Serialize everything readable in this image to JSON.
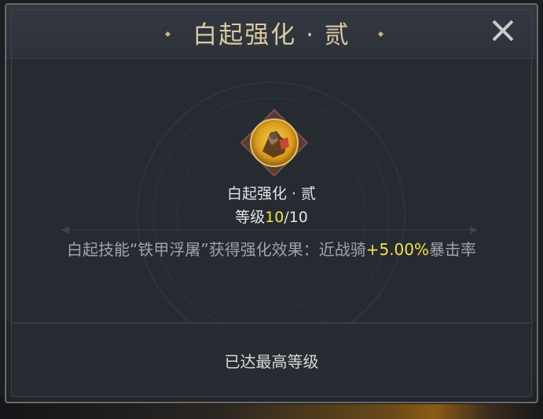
{
  "dialog": {
    "title": "白起强化 · 贰",
    "close_icon": "close-x-icon"
  },
  "skill": {
    "icon": "warrior-portrait-icon",
    "name": "白起强化 · 贰",
    "level_label": "等级",
    "level_current": "10",
    "level_separator": "/",
    "level_max": "10"
  },
  "effect": {
    "prefix": "白起技能“铁甲浮屠”获得强化效果：近战骑",
    "value": "+5.00%",
    "suffix": "暴击率"
  },
  "footer": {
    "status": "已达最高等级"
  },
  "colors": {
    "highlight": "#f2e04a",
    "title": "#d9c9a2",
    "frame_accent": "#c8a23c"
  }
}
